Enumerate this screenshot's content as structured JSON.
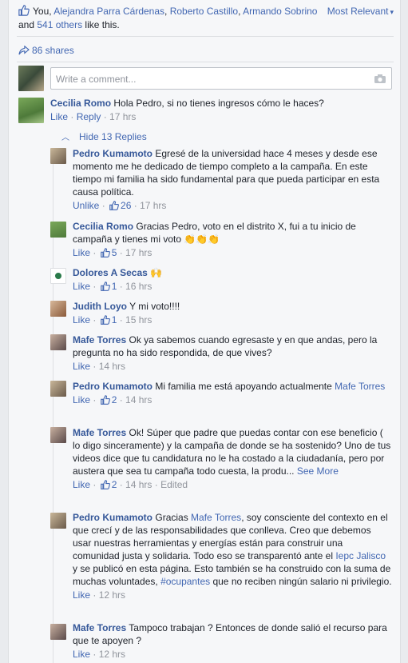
{
  "likes": {
    "prefix": "You, ",
    "name1": "Alejandra Parra Cárdenas",
    "sep1": ", ",
    "name2": "Roberto Castillo",
    "sep2": ", ",
    "name3": "Armando Sobrino",
    "mid": " and ",
    "others": "541 others",
    "suffix": " like this."
  },
  "sort_label": "Most Relevant",
  "shares": "86 shares",
  "comment_placeholder": "Write a comment...",
  "main_comment": {
    "author": "Cecilia Romo",
    "text": "Hola Pedro, si no tienes ingresos cómo le haces?",
    "like": "Like",
    "reply": "Reply",
    "time": "17 hrs"
  },
  "hide_replies": "Hide 13 Replies",
  "replies": [
    {
      "author": "Pedro Kumamoto",
      "text": "Egresé de la universidad hace 4 meses y desde ese momento me he dedicado de tiempo completo a la campaña. En este tiempo mi familia ha sido fundamental para que pueda participar en esta causa política.",
      "like": "Unlike",
      "count": "26",
      "time": "17 hrs"
    },
    {
      "author": "Cecilia Romo",
      "text": "Gracias Pedro, voto en el distrito X, fui a tu inicio de campaña y tienes mi voto 👏👏👏",
      "like": "Like",
      "count": "5",
      "time": "17 hrs"
    },
    {
      "author": "Dolores A Secas",
      "text": "🙌",
      "like": "Like",
      "count": "1",
      "time": "16 hrs"
    },
    {
      "author": "Judith Loyo",
      "text": "Y mi voto!!!!",
      "like": "Like",
      "count": "1",
      "time": "15 hrs"
    },
    {
      "author": "Mafe Torres",
      "text": "Ok ya sabemos cuando egresaste y en que andas, pero la pregunta no ha sido respondida, de que vives?",
      "like": "Like",
      "count": "",
      "time": "14 hrs"
    },
    {
      "author": "Pedro Kumamoto",
      "text": "Mi familia me está apoyando actualmente",
      "mention": "Mafe Torres",
      "like": "Like",
      "count": "2",
      "time": "14 hrs"
    },
    {
      "author": "Mafe Torres",
      "text": "Ok! Súper que padre que puedas contar con ese beneficio ( lo digo sinceramente) y la campaña de donde se ha sostenido? Uno de tus videos dice que tu candidatura no le ha costado a la ciudadanía, pero por austera que sea tu campaña todo cuesta, la produ...",
      "see_more": "See More",
      "like": "Like",
      "count": "2",
      "time": "14 hrs",
      "edited": "Edited"
    },
    {
      "author": "Pedro Kumamoto",
      "text_a": "Gracias ",
      "mention": "Mafe Torres",
      "text_b": ", soy consciente del contexto en el que crecí y de las responsabilidades que conlleva. Creo que debemos usar nuestras herramientas y energías están para construir una comunidad justa y solidaria. Todo eso se transparentó ante el ",
      "link1": "Iepc Jalisco",
      "text_c": " y se publicó en esta página. Esto también se ha construido con la suma de muchas voluntades, ",
      "hashtag": "#ocupantes",
      "text_d": " que no reciben ningún salario ni privilegio.",
      "like": "Like",
      "count": "",
      "time": "12 hrs"
    },
    {
      "author": "Mafe Torres",
      "text": "Tampoco trabajan ? Entonces de donde salió el recurso para que te apoyen ?",
      "like": "Like",
      "count": "",
      "time": "12 hrs"
    }
  ],
  "colors": {
    "link": "#4267b2",
    "name": "#365899",
    "meta": "#90949c",
    "bg": "#f6f7f9"
  }
}
